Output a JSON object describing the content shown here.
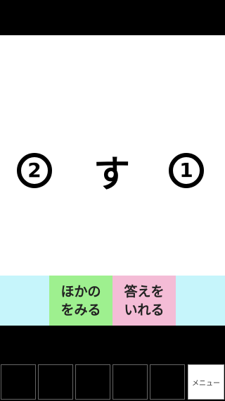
{
  "puzzle": {
    "left_symbol": "2",
    "center_char": "す",
    "right_symbol": "1"
  },
  "actions": {
    "look_line1": "ほかの",
    "look_line2": "をみる",
    "answer_line1": "答えを",
    "answer_line2": "いれる"
  },
  "inventory": {
    "slots": [
      "",
      "",
      "",
      "",
      ""
    ],
    "menu_label": "メニュー"
  },
  "colors": {
    "action_bar": "#c6f5fb",
    "look_button": "#9ef08f",
    "answer_button": "#f4bcd6"
  }
}
